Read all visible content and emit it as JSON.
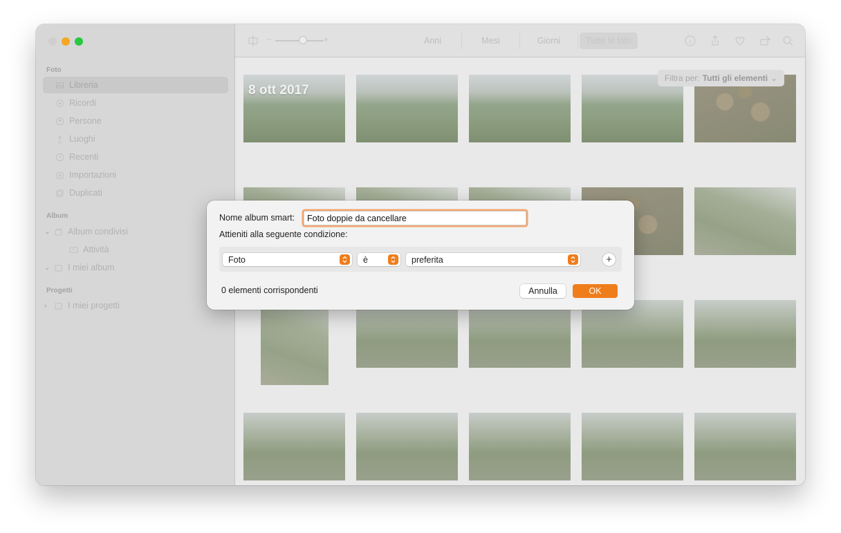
{
  "sidebar": {
    "sections": [
      {
        "title": "Foto"
      },
      {
        "title": "Album"
      },
      {
        "title": "Progetti"
      }
    ],
    "items": [
      {
        "label": "Libreria",
        "icon": "photo-library-icon"
      },
      {
        "label": "Ricordi",
        "icon": "memories-icon"
      },
      {
        "label": "Persone",
        "icon": "people-icon"
      },
      {
        "label": "Luoghi",
        "icon": "places-icon"
      },
      {
        "label": "Recenti",
        "icon": "recent-icon"
      },
      {
        "label": "Importazioni",
        "icon": "imports-icon"
      },
      {
        "label": "Duplicati",
        "icon": "duplicates-icon"
      },
      {
        "label": "Album condivisi",
        "icon": "shared-album-icon"
      },
      {
        "label": "Attività",
        "icon": "activity-icon"
      },
      {
        "label": "I miei album",
        "icon": "folder-icon"
      },
      {
        "label": "I miei progetti",
        "icon": "folder-icon"
      }
    ]
  },
  "toolbar": {
    "zoom_minus": "−",
    "zoom_plus": "+",
    "tabs": [
      "Anni",
      "Mesi",
      "Giorni",
      "Tutte le foto"
    ],
    "active_tab": "Tutte le foto"
  },
  "content": {
    "date_label": "8 ott 2017",
    "filter_prefix": "Filtra per:",
    "filter_value": "Tutti gli elementi",
    "filter_chevron": "⌄"
  },
  "dialog": {
    "name_label": "Nome album smart:",
    "name_value": "Foto doppie da cancellare",
    "condition_label": "Attieniti alla seguente condizione:",
    "condition": {
      "field": "Foto",
      "operator": "è",
      "value": "preferita"
    },
    "add_symbol": "+",
    "match_count": "0 elementi corrispondenti",
    "cancel_label": "Annulla",
    "ok_label": "OK"
  },
  "colors": {
    "accent": "#f07d1c",
    "focus_ring": "#f2a56f"
  }
}
